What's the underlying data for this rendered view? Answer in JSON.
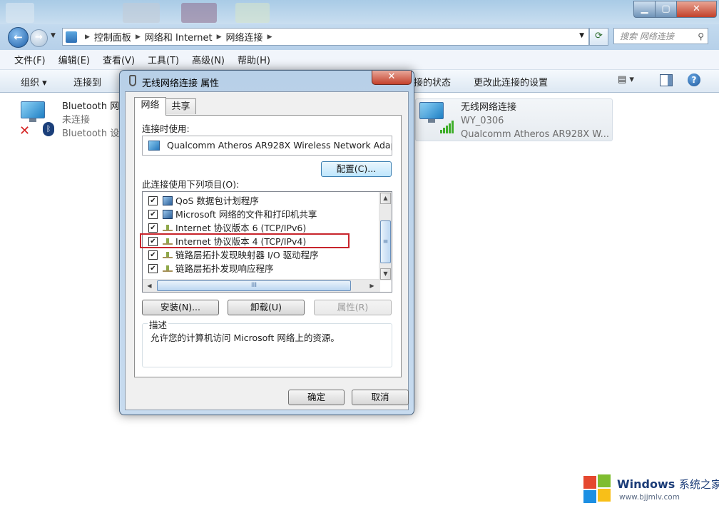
{
  "window": {
    "min_glyph": "▁",
    "max_glyph": "▢",
    "close_glyph": "✕"
  },
  "address": {
    "breadcrumbs": [
      "控制面板",
      "网络和 Internet",
      "网络连接"
    ],
    "search_placeholder": "搜索 网络连接"
  },
  "menu": [
    "文件(F)",
    "编辑(E)",
    "查看(V)",
    "工具(T)",
    "高级(N)",
    "帮助(H)"
  ],
  "toolbar": {
    "organize": "组织 ▾",
    "connect_to": "连接到",
    "view_status": "接的状态",
    "change_settings": "更改此连接的设置",
    "view_glyph": "▤ ▾",
    "help_glyph": "?"
  },
  "connections": {
    "bluetooth": {
      "name": "Bluetooth 网络连接",
      "status": "未连接",
      "device": "Bluetooth 设备",
      "badge_glyph": "✕",
      "bt_glyph": "ᛒ"
    },
    "wireless": {
      "name": "无线网络连接",
      "network": "WY_0306",
      "device": "Qualcomm Atheros AR928X W..."
    }
  },
  "dialog": {
    "title": "无线网络连接 属性",
    "close_glyph": "✕",
    "tabs": [
      "网络",
      "共享"
    ],
    "connect_using_label": "连接时使用:",
    "adapter_name": "Qualcomm Atheros AR928X Wireless Network Adapter",
    "configure_button": "配置(C)...",
    "items_label": "此连接使用下列项目(O):",
    "items": [
      {
        "label": "QoS 数据包计划程序",
        "checked": true,
        "icon": "pc"
      },
      {
        "label": "Microsoft 网络的文件和打印机共享",
        "checked": true,
        "icon": "pc"
      },
      {
        "label": "Internet 协议版本 6 (TCP/IPv6)",
        "checked": true,
        "icon": "net"
      },
      {
        "label": "Internet 协议版本 4 (TCP/IPv4)",
        "checked": true,
        "icon": "net"
      },
      {
        "label": "链路层拓扑发现映射器 I/O 驱动程序",
        "checked": true,
        "icon": "net"
      },
      {
        "label": "链路层拓扑发现响应程序",
        "checked": true,
        "icon": "net"
      }
    ],
    "check_glyph": "✔",
    "scroll_up": "▲",
    "scroll_down": "▼",
    "scroll_left": "◀",
    "scroll_right": "▶",
    "thumb_grip": "≡",
    "hthumb_grip": "III",
    "install_button": "安装(N)...",
    "uninstall_button": "卸载(U)",
    "properties_button": "属性(R)",
    "description_title": "描述",
    "description_text": "允许您的计算机访问 Microsoft 网络上的资源。",
    "ok_button": "确定",
    "cancel_button": "取消"
  },
  "watermark": {
    "brand": "Windows",
    "brand_zh": "系统之家",
    "url": "www.bjjmlv.com"
  }
}
